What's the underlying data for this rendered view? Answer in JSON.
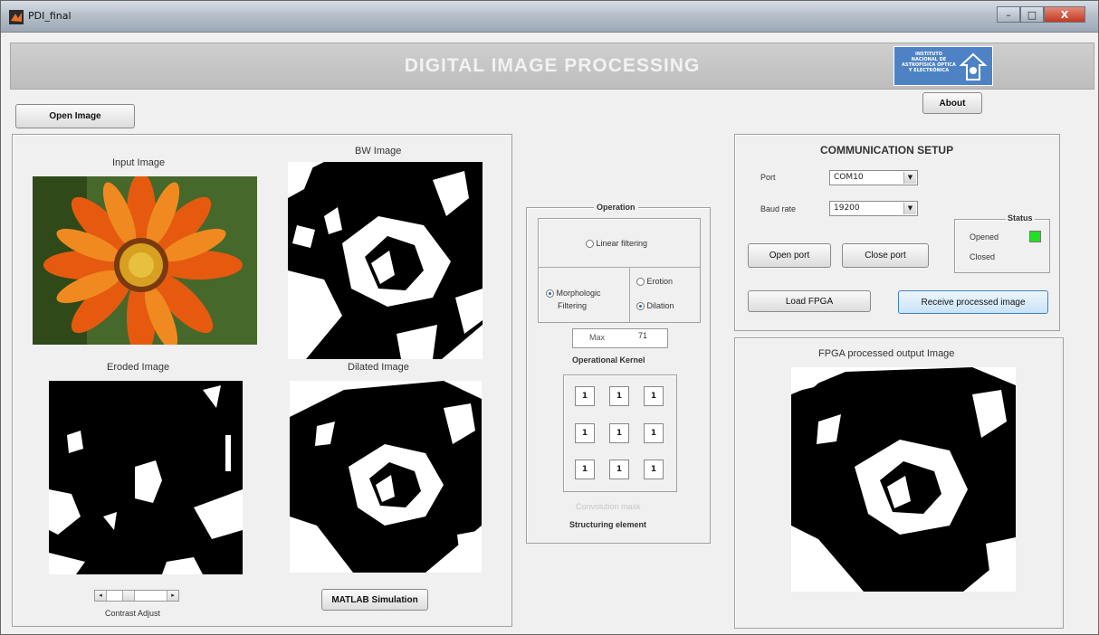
{
  "window": {
    "title": "PDI_final",
    "controls": {
      "minimize": "–",
      "maximize": "□",
      "close": "X"
    }
  },
  "header": {
    "title": "DIGITAL IMAGE PROCESSING",
    "logo_text": "INSTITUTO NACIONAL DE ASTROFÍSICA ÓPTICA Y ELECTRÓNICA"
  },
  "toolbar": {
    "open_image": "Open Image",
    "about": "About"
  },
  "images": {
    "input": "Input Image",
    "bw": "BW Image",
    "eroded": "Eroded Image",
    "dilated": "Dilated Image",
    "contrast": "Contrast Adjust",
    "matlab": "MATLAB Simulation"
  },
  "operation": {
    "title": "Operation",
    "linear": "Linear filtering",
    "morph_line1": "Morphologic",
    "morph_line2": "Filtering",
    "erosion": "Erotion",
    "dilation": "Dilation",
    "max_label": "Max",
    "max_value": "71",
    "kernel_title": "Operational Kernel",
    "kernel": [
      "1",
      "1",
      "1",
      "1",
      "1",
      "1",
      "1",
      "1",
      "1"
    ],
    "conv_mask": "Convolution mask",
    "struct_elem": "Structuring element"
  },
  "comm": {
    "title": "COMMUNICATION SETUP",
    "port_label": "Port",
    "port_value": "COM10",
    "baud_label": "Baud rate",
    "baud_value": "19200",
    "status_title": "Status",
    "opened": "Opened",
    "closed": "Closed",
    "status_color": "#22e022",
    "open_port": "Open port",
    "close_port": "Close port",
    "load_fpga": "Load FPGA",
    "receive": "Receive processed image"
  },
  "fpga": {
    "title": "FPGA processed output Image"
  },
  "colors": {
    "accent": "#4d83c4",
    "panel_bg": "#f0f0f0"
  }
}
